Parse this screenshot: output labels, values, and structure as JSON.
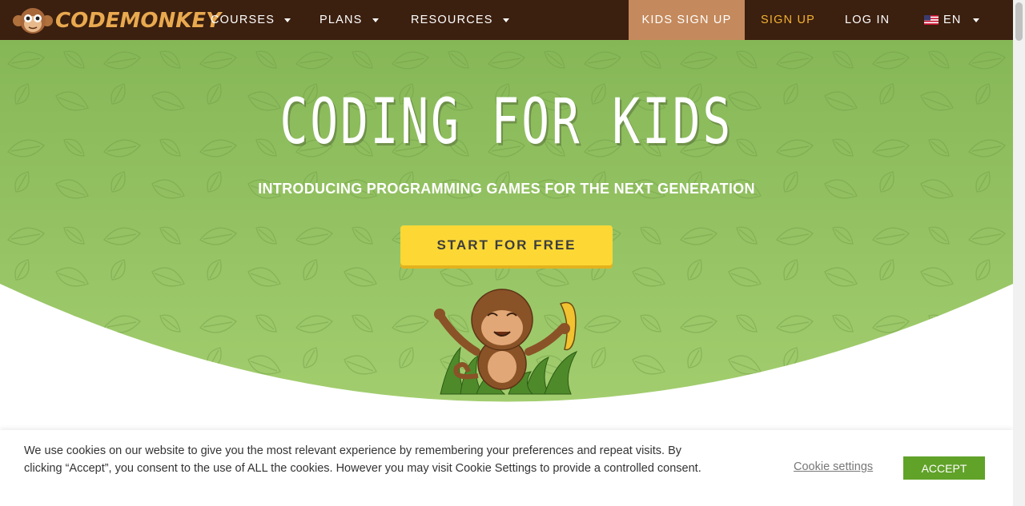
{
  "brand": {
    "logo_text": "CODEMONKEY",
    "logo_icon": "monkey-face-icon",
    "nav_bg": "#3b1f0f",
    "accent": "#f2b233"
  },
  "nav": {
    "courses": "COURSES",
    "plans": "PLANS",
    "resources": "RESOURCES",
    "kids_signup": "KIDS SIGN UP",
    "signup": "SIGN UP",
    "login": "LOG IN",
    "language": "EN",
    "flag_icon": "us-flag-icon"
  },
  "hero": {
    "title": "CODING FOR KIDS",
    "subtitle": "INTRODUCING PROGRAMMING GAMES FOR THE NEXT GENERATION",
    "cta": "START FOR FREE",
    "bg_color": "#8dbe5c",
    "cta_color": "#fdd835",
    "illustration": "monkey-holding-banana-illustration"
  },
  "cookie": {
    "text": "We use cookies on our website to give you the most relevant experience by remembering your preferences and repeat visits. By clicking “Accept”, you consent to the use of ALL the cookies. However you may visit Cookie Settings to provide a controlled consent.",
    "settings": "Cookie settings",
    "accept": "ACCEPT",
    "accept_color": "#61a229"
  }
}
